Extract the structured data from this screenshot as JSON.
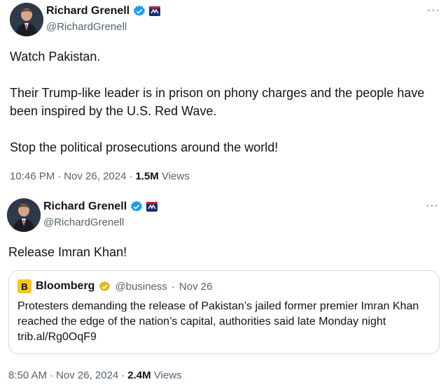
{
  "tweets": [
    {
      "author": {
        "name": "Richard Grenell",
        "handle": "@RichardGrenell"
      },
      "more": "···",
      "paragraphs": [
        "Watch Pakistan.",
        "Their Trump-like leader is in prison on phony charges and the people have been inspired by the U.S. Red Wave.",
        "Stop the political prosecutions around the world!"
      ],
      "time": "10:46 PM",
      "sep": "·",
      "date": "Nov 26, 2024",
      "views_count": "1.5M",
      "views_label": "Views"
    },
    {
      "author": {
        "name": "Richard Grenell",
        "handle": "@RichardGrenell"
      },
      "more": "···",
      "text": "Release Imran Khan!",
      "quote": {
        "logo_letter": "B",
        "name": "Bloomberg",
        "handle": "@business",
        "sep": "·",
        "date": "Nov 26",
        "text": "Protesters demanding the release of Pakistan’s jailed former premier Imran Khan reached the edge of the nation’s capital, authorities said late Monday night",
        "link": "trib.al/Rg0OqF9"
      },
      "time": "8:50 AM",
      "sep": "·",
      "date": "Nov 26, 2024",
      "views_count": "2.4M",
      "views_label": "Views"
    }
  ],
  "colors": {
    "verified_blue": "#1d9bf0",
    "gold_check": "#e2b719",
    "bloomberg_yellow": "#f5c518",
    "secondary_text": "#536471"
  }
}
